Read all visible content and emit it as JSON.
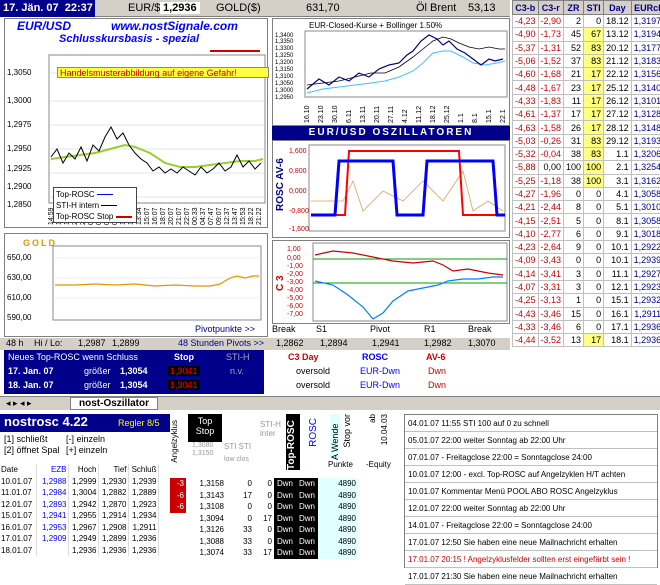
{
  "topbar": {
    "date": "17. Jän. 07",
    "time": "22:37",
    "eur_label": "EUR/$",
    "eur_value": "1,2936",
    "gold_label": "GOLD($)",
    "gold_value": "631,70",
    "oil_label": "Öl Brent",
    "oil_value": "53,13"
  },
  "chart1": {
    "title1": "EUR/USD",
    "site": "www.nostSignale.com",
    "title2": "Schlusskursbasis - spezial",
    "warning": "Handelsmusterabbildung auf eigene Gefahr!",
    "y_ticks": [
      "1,3050",
      "1,3000",
      "1,2975",
      "1,2950",
      "1,2925",
      "1,2900",
      "1,2875",
      "1,2850"
    ],
    "x_ticks": [
      "14:59",
      "15:47",
      "17:30",
      "20:47",
      "22:47",
      "01:32",
      "03:32",
      "05:32",
      "07:30",
      "10:07",
      "11:07",
      "13:34",
      "15:07",
      "16:07",
      "18:07",
      "20:07",
      "21:07",
      "22:07",
      "00:33",
      "04:37",
      "07:47",
      "09:07",
      "12:37",
      "13:47",
      "15:53",
      "18:22",
      "21:22"
    ],
    "legend": [
      "Top-ROSC",
      "STI-H intern",
      "Top-ROSC Stop"
    ]
  },
  "gold": {
    "title": "GOLD",
    "y_ticks": [
      "650,00",
      "630,00",
      "610,00",
      "590,00"
    ],
    "footer": "Pivotpunkte >>"
  },
  "chart2": {
    "title": "EUR-Closed-Kurse + Bollinger 1.50%",
    "y_ticks": [
      "1,3400",
      "1,3350",
      "1,3300",
      "1,3250",
      "1,3200",
      "1,3150",
      "1,3100",
      "1,3050",
      "1,3000",
      "1,2950",
      "1,2900",
      "1,2850",
      "1,2800",
      "1,2750",
      "1,2700",
      "1,2650",
      "1,2600",
      "1,2550",
      "1,2500"
    ],
    "x_ticks": [
      "16.10",
      "23.10",
      "30.10",
      "6.11",
      "13.11",
      "20.11",
      "27.11",
      "4.12",
      "11.12",
      "18.12",
      "25.12",
      "1.1",
      "8.1",
      "15.1",
      "22.1"
    ]
  },
  "osc_header": "EUR/USD OSZILLATOREN",
  "chart3": {
    "label": "ROSC AV-6",
    "y_ticks": [
      "1,600",
      "0,800",
      "0,000",
      "-0,800",
      "-1,600"
    ]
  },
  "chart4": {
    "label": "C 3",
    "y_ticks": [
      "1,00",
      "0,00",
      "-1,00",
      "-2,00",
      "-3,00",
      "-4,00",
      "-5,00",
      "-6,00",
      "-7,00",
      "-8,00"
    ]
  },
  "pivot": {
    "labels": [
      "Break",
      "S1",
      "Pivot",
      "R1",
      "Break"
    ],
    "values": [
      "1,2862",
      "1,2894",
      "1,2941",
      "1,2982",
      "1,3070"
    ]
  },
  "midbar": {
    "a": "48 h",
    "b": "Hi / Lo:",
    "hi": "1,2987",
    "lo": "1,2899",
    "c": "48 Stunden Pivots >>"
  },
  "tableA": {
    "head": [
      "Neues Top-ROSC wenn Schluss",
      "Stop",
      "STI-H"
    ],
    "rows": [
      [
        "17. Jan. 07",
        "größer",
        "1,3054",
        "1,3041",
        "n.v."
      ],
      [
        "18. Jan. 07",
        "größer",
        "1,3054",
        "1,3041",
        ""
      ]
    ]
  },
  "tableB": {
    "head": [
      "C3 Day",
      "ROSC",
      "AV-6"
    ],
    "rows": [
      [
        "oversold",
        "EUR-Dwn",
        "Dwn"
      ],
      [
        "oversold",
        "EUR-Dwn",
        "Dwn"
      ]
    ]
  },
  "right": {
    "headers": [
      "C3-b",
      "C3-r",
      "ZR",
      "STI",
      "Day",
      "EURcl"
    ],
    "rows": [
      [
        "-4,23",
        "-2,90",
        "2",
        "0",
        "18.12",
        "1,3197"
      ],
      [
        "-4,90",
        "-1,73",
        "45",
        "67",
        "13.12",
        "1,3194"
      ],
      [
        "-5,37",
        "-1,31",
        "52",
        "83",
        "20.12",
        "1,3177"
      ],
      [
        "-5,06",
        "-1,52",
        "37",
        "83",
        "21.12",
        "1,3183"
      ],
      [
        "-4,60",
        "-1,68",
        "21",
        "17",
        "22.12",
        "1,3156"
      ],
      [
        "-4,48",
        "-1,67",
        "23",
        "17",
        "25.12",
        "1,3140"
      ],
      [
        "-4,33",
        "-1,83",
        "11",
        "17",
        "26.12",
        "1,3101"
      ],
      [
        "-4,61",
        "-1,37",
        "17",
        "17",
        "27.12",
        "1,3128"
      ],
      [
        "-4,63",
        "-1,58",
        "26",
        "17",
        "28.12",
        "1,3148"
      ],
      [
        "-5,03",
        "-0,26",
        "31",
        "83",
        "29.12",
        "1,3193"
      ],
      [
        "-5,32",
        "-0,04",
        "38",
        "83",
        "1.1",
        "1,3206"
      ],
      [
        "-5,88",
        "0,00",
        "100",
        "100",
        "2.1",
        "1,3254"
      ],
      [
        "-5,25",
        "-1,18",
        "38",
        "100",
        "3.1",
        "1,3162"
      ],
      [
        "-4,27",
        "-1,96",
        "0",
        "0",
        "4.1",
        "1,3058"
      ],
      [
        "-4,21",
        "-2,44",
        "8",
        "0",
        "5.1",
        "1,3010"
      ],
      [
        "-4,15",
        "-2,51",
        "5",
        "0",
        "8.1",
        "1,3058"
      ],
      [
        "-4,10",
        "-2,77",
        "6",
        "0",
        "9.1",
        "1,3018"
      ],
      [
        "-4,23",
        "-2,64",
        "9",
        "0",
        "10.1",
        "1,2922"
      ],
      [
        "-4,09",
        "-3,43",
        "0",
        "0",
        "10.1",
        "1,2939"
      ],
      [
        "-4,14",
        "-3,41",
        "3",
        "0",
        "11.1",
        "1,2927"
      ],
      [
        "-4,07",
        "-3,31",
        "3",
        "0",
        "12.1",
        "1,2923"
      ],
      [
        "-4,25",
        "-3,13",
        "1",
        "0",
        "15.1",
        "1,2932"
      ],
      [
        "-4,43",
        "-3,46",
        "15",
        "0",
        "16.1",
        "1,2911"
      ],
      [
        "-4,33",
        "-3,46",
        "6",
        "0",
        "17.1",
        "1,2936"
      ],
      [
        "-4,44",
        "-3,52",
        "13",
        "17",
        "18.1",
        "1,2936"
      ]
    ]
  },
  "tab": {
    "label": "nost-Oszillator"
  },
  "nost": {
    "title": "nostrosc 4.22",
    "regler": "Regler 8/5",
    "opt1": "[1] schließt",
    "opt1b": "[-] einzeln",
    "opt2": "[2] öffnet Spal",
    "opt2b": "[+] einzeln",
    "cols": [
      "Date",
      "EZB",
      "Hoch",
      "Tief",
      "Schluß"
    ],
    "rows": [
      [
        "10.01.07",
        "1,2988",
        "1,2999",
        "1,2930",
        "1,2939"
      ],
      [
        "11.01.07",
        "1,2984",
        "1,3004",
        "1,2882",
        "1,2889"
      ],
      [
        "12.01.07",
        "1,2893",
        "1,2942",
        "1,2870",
        "1,2923"
      ],
      [
        "15.01.07",
        "1,2941",
        "1,2955",
        "1,2914",
        "1,2934"
      ],
      [
        "16.01.07",
        "1,2953",
        "1,2967",
        "1,2908",
        "1,2911"
      ],
      [
        "17.01.07",
        "1,2909",
        "1,2949",
        "1,2899",
        "1,2936"
      ],
      [
        "18.01.07",
        "",
        "1,2936",
        "1,2936",
        "1,2936"
      ]
    ]
  },
  "mid_lower": {
    "angel": "Angelzyklus",
    "top_stop": "Top Stop",
    "sti_clone": "STI STI",
    "low_clos": "low clos",
    "sti_h": "STI-H inter",
    "top_rosc": "Top-ROSC",
    "rosc": "ROSC",
    "awende": "A Wende",
    "stop_vor": "Stop vor",
    "ab": "ab",
    "ab_date": "10.04.03",
    "punkte": "Punkte",
    "equity": "-Equity",
    "v1": "1,3080",
    "v2": "1,3150",
    "rows": [
      [
        "-3",
        "1,3158",
        "0",
        "0",
        "Dwn",
        "Dwn",
        "4890"
      ],
      [
        "-6",
        "1,3143",
        "17",
        "0",
        "Dwn",
        "Dwn",
        "4890"
      ],
      [
        "-6",
        "1,3108",
        "0",
        "0",
        "Dwn",
        "Dwn",
        "4890"
      ],
      [
        "",
        "1,3094",
        "0",
        "17",
        "Dwn",
        "Dwn",
        "4890"
      ],
      [
        "",
        "1,3126",
        "33",
        "0",
        "Dwn",
        "Dwn",
        "4890"
      ],
      [
        "",
        "1,3088",
        "33",
        "0",
        "Dwn",
        "Dwn",
        "4890"
      ],
      [
        "",
        "1,3074",
        "33",
        "17",
        "Dwn",
        "Dwn",
        "4890"
      ]
    ]
  },
  "messages": [
    "04.01.07 11:55 STI 100 auf 0 zu schnell",
    "05.01.07 22:00 weiter Sonntag ab 22:00 Uhr",
    "07.01.07 - Freitagclose 22:00 = Sonntagclose 24:00",
    "10.01.07 12:00 - excl. Top-ROSC auf Angelzyklen H/T achten",
    "10.01.07 Kommentar Menü POOL ABO ROSC Angelzyklus",
    "12.01.07 22:00 weiter Sonntag ab 22:00 Uhr",
    "14.01.07 - Freitagclose 22:00 = Sonntagclose 24:00",
    "17.01.07 12:50 Sie haben eine neue Mailnachricht erhalten",
    "17.01.07 20:15 ! Angelzyklusfelder sollten erst eingefärbt sein !",
    "17.01.07 21:30 Sie haben eine neue Mailnachricht erhalten"
  ],
  "colors": {
    "navy": "#00008b",
    "red": "#cc0000",
    "blue": "#0000ff",
    "yellow": "#ffff80",
    "green": "#9acd32"
  }
}
